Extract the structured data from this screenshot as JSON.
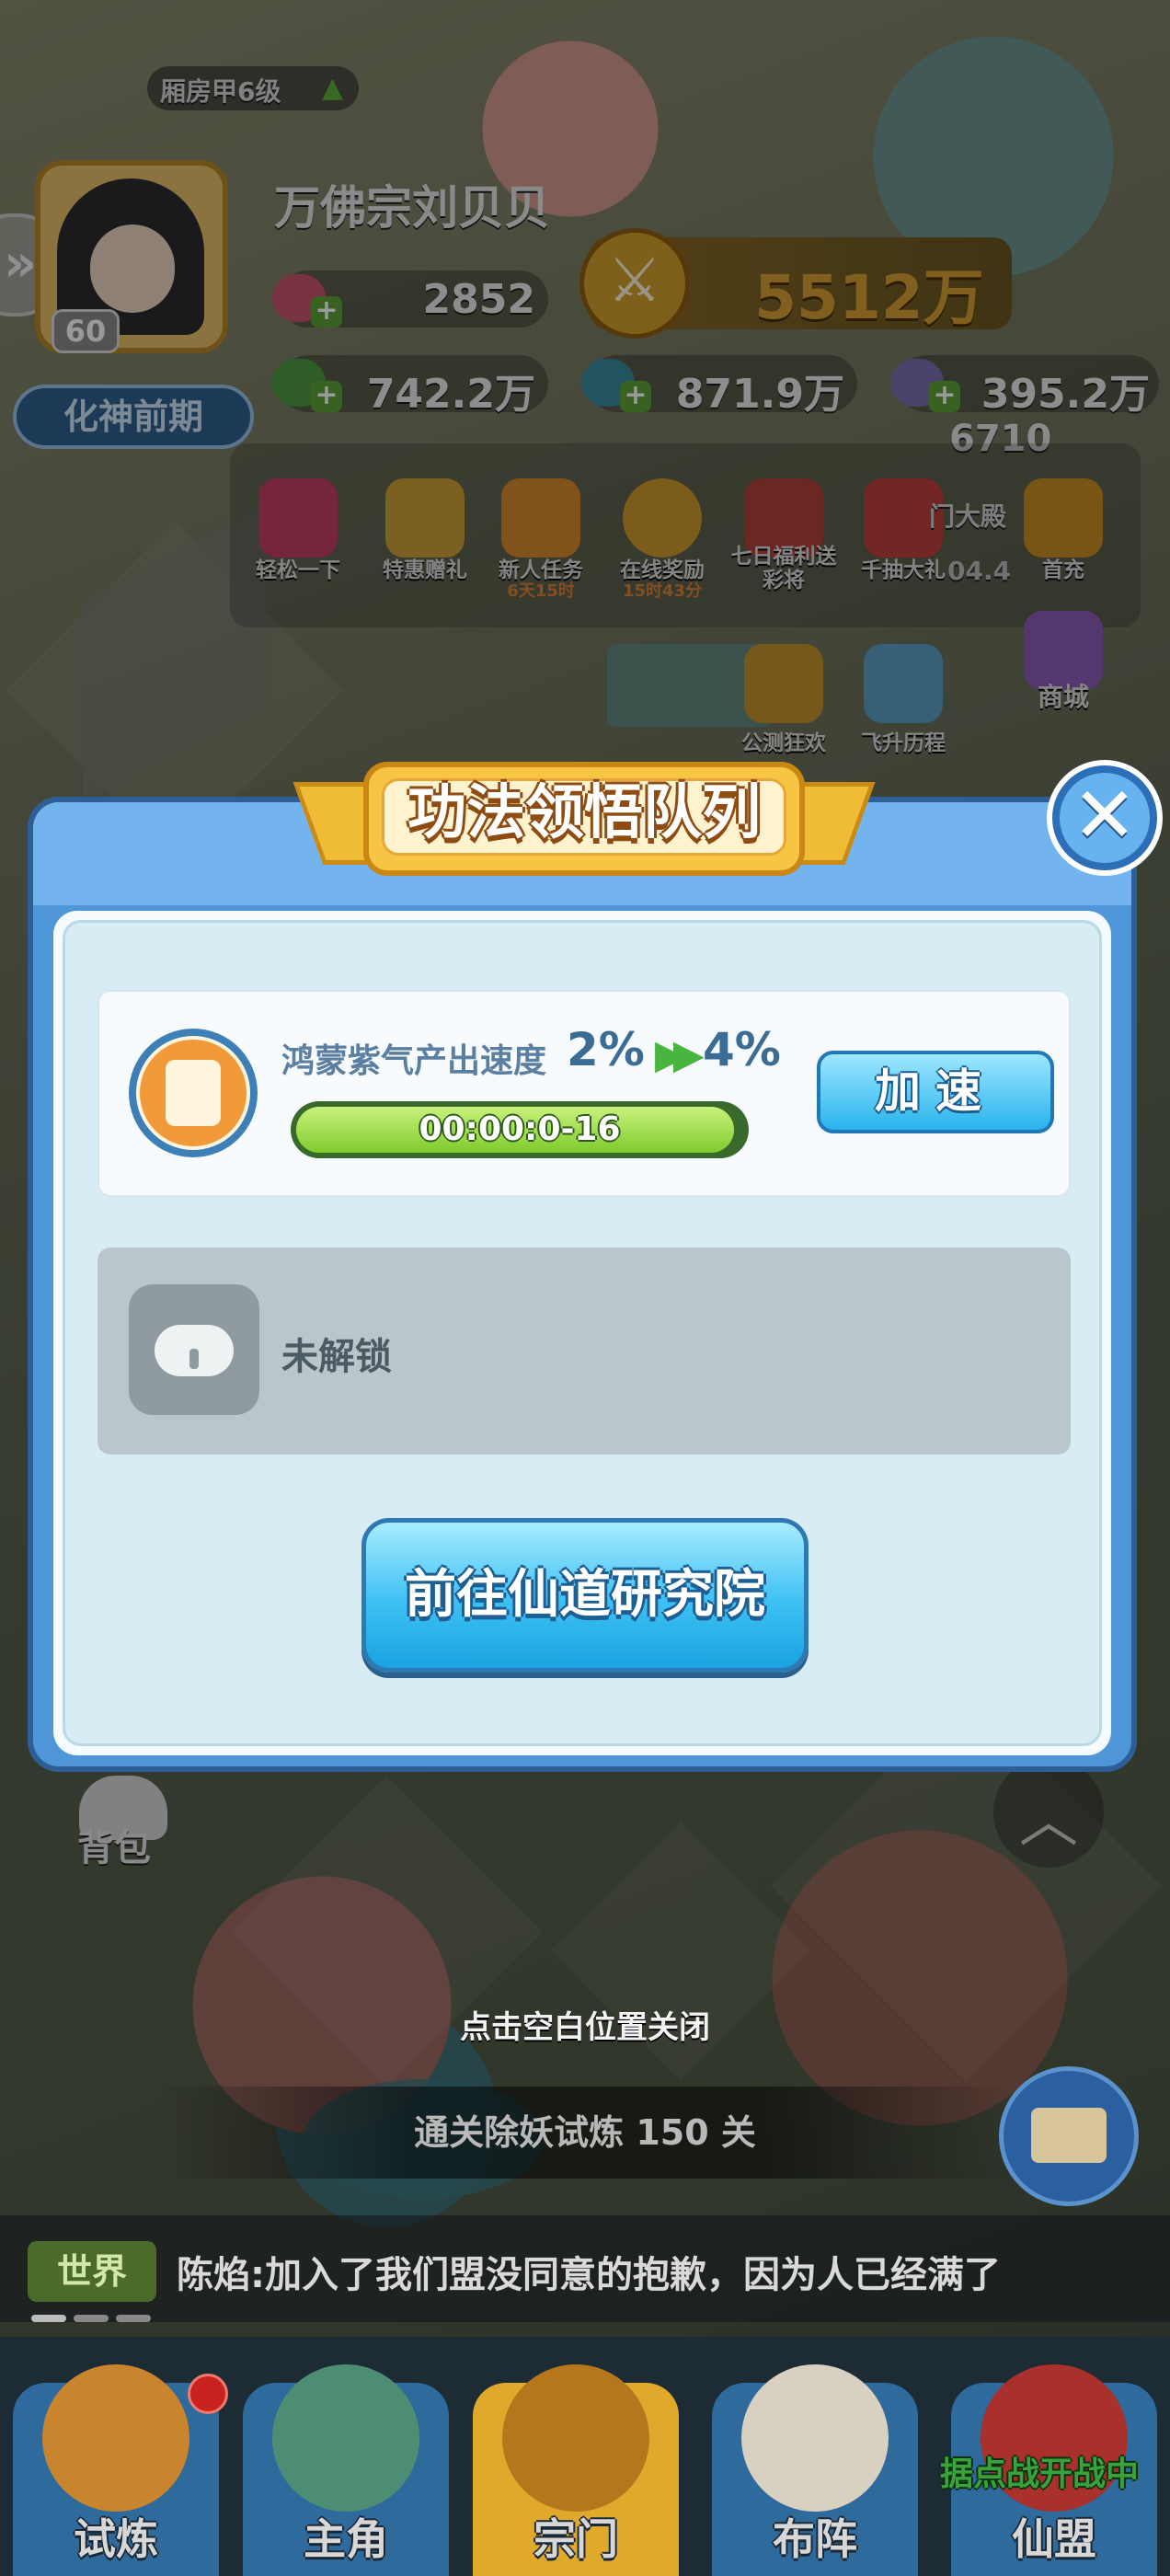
{
  "player": {
    "dwelling": "厢房甲6级",
    "name": "万佛宗刘贝贝",
    "level": "60",
    "realm": "化神前期",
    "battle_power": "5512万"
  },
  "resources": {
    "peach": "2852",
    "cloud": "742.2万",
    "jade": "871.9万",
    "third": "395.2万",
    "extra_count": "6710"
  },
  "menu": [
    {
      "label": "轻松一下",
      "sub": "",
      "icon": "game-controller-icon"
    },
    {
      "label": "特惠赠礼",
      "sub": "",
      "icon": "gift-lantern-icon"
    },
    {
      "label": "新人任务",
      "sub": "6天15时",
      "icon": "medal-icon"
    },
    {
      "label": "在线奖励",
      "sub": "15时43分",
      "icon": "clock-icon"
    },
    {
      "label": "七日福利送彩将",
      "sub": "",
      "icon": "calendar-gift-icon"
    },
    {
      "label": "千抽大礼",
      "sub": "",
      "icon": "gift-box-icon"
    },
    {
      "label": "首充",
      "sub": "",
      "icon": "treasure-chest-icon"
    },
    {
      "label": "商城",
      "sub": "",
      "icon": "shop-icon"
    },
    {
      "label": "公测狂欢",
      "sub": "",
      "icon": "celebration-icon"
    },
    {
      "label": "飞升历程",
      "sub": "",
      "icon": "ascension-icon"
    }
  ],
  "menu_partial": {
    "hall": "门大殿",
    "hall_value": "04.4"
  },
  "backpack_label": "背包",
  "dialog": {
    "title": "功法领悟队列",
    "queue": {
      "description": "鸿蒙紫气产出速度",
      "from": "2%",
      "to": "4%",
      "timer": "00:00:0-16",
      "progress": 0.98,
      "speed_button": "加速"
    },
    "locked_text": "未解锁",
    "go_button": "前往仙道研究院"
  },
  "close_hint": "点击空白位置关闭",
  "quest": "通关除妖试炼 150 关",
  "chat": {
    "channel": "世界",
    "message": "陈焰:加入了我们盟没同意的抱歉，因为人已经满了"
  },
  "nav": [
    {
      "label": "试炼"
    },
    {
      "label": "主角"
    },
    {
      "label": "宗门"
    },
    {
      "label": "布阵"
    },
    {
      "label": "仙盟",
      "promo": "据点战开战中"
    }
  ]
}
